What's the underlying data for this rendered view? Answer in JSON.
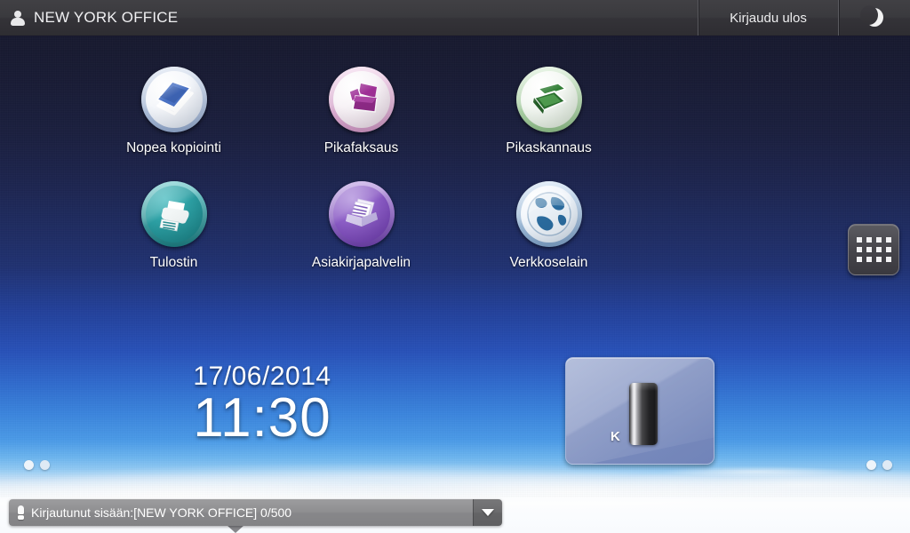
{
  "header": {
    "user_icon": "user-icon",
    "title": "NEW YORK OFFICE",
    "logout_label": "Kirjaudu ulos",
    "sleep_icon": "moon-icon"
  },
  "apps": [
    {
      "label": "Nopea kopiointi",
      "icon": "copy-book-icon",
      "color": "#3a63b8"
    },
    {
      "label": "Pikafaksaus",
      "icon": "fax-machine-icon",
      "color": "#963a8e"
    },
    {
      "label": "Pikaskannaus",
      "icon": "scanner-icon",
      "color": "#2f7a33"
    },
    {
      "label": "Tulostin",
      "icon": "printer-icon",
      "color": "#1f8e92"
    },
    {
      "label": "Asiakirjapalvelin",
      "icon": "document-server-icon",
      "color": "#7b4ab5"
    },
    {
      "label": "Verkkoselain",
      "icon": "globe-icon",
      "color": "#2c6fa8"
    }
  ],
  "drawer": {
    "icon": "app-grid-icon"
  },
  "clock": {
    "date": "17/06/2014",
    "time": "11:30"
  },
  "toner_widget": {
    "label": "K",
    "icon": "toner-cartridge-icon"
  },
  "page_indicator": {
    "left_dots": 2,
    "right_dots": 2
  },
  "status_bar": {
    "icon": "alert-icon",
    "message": "Kirjautunut sisään:[NEW YORK OFFICE] 0/500",
    "expand_icon": "chevron-down-icon"
  },
  "colors": {
    "header_bg": "#3a393e",
    "sky_top": "#161629",
    "sky_mid": "#2750b8",
    "sky_low": "#63b1ef",
    "cloud": "#f2f5f9",
    "status_bar_bg": "#8e8e90"
  }
}
